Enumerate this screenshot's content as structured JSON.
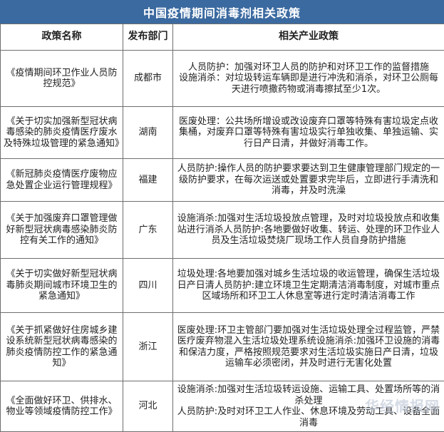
{
  "title": "中国疫情期间消毒剂相关政策",
  "headers": {
    "name": "政策名称",
    "region": "发布部门",
    "policy": "相关产业政策"
  },
  "rows": [
    {
      "name": "《疫情期间环卫作业人员防控规范》",
      "region": "成都市",
      "policy": "人员防护：加强对环卫人员的防护和对环卫工作的监督措施\n设施消杀：对垃圾转运车辆即是进行冲洗和消杀，对环卫公厕每天进行喷撒药物或消毒擦拭至少1次。"
    },
    {
      "name": "《关于切实加强新型冠状病毒感染的肺炎疫情医疗废水及特殊垃圾管理的紧急通知》",
      "region": "湖南",
      "policy": "医废处理：公共场所增设或改设废弃口罩等特殊有害垃圾定点收集桶，对废弃口罩等特殊有害垃圾实行单独收集、单独运输、实行日产日清，并做好消毒工作。"
    },
    {
      "name": "《新冠肺炎疫情医疗废物应急处置企业运行管理规程》",
      "region": "福建",
      "policy": "人员防护:操作人员的防护要求要达到卫生健康管理部门规定的一级防护要求，在每次运送或处置要求完毕后，立即进行手清洗和消毒，并及时洗澡"
    },
    {
      "name": "《关于加强废弃口罩管理做好新型冠状病毒感染肺炎防控有关工作的通知》",
      "region": "广东",
      "policy": "设施消杀:加强对生活垃圾投放点管理，及时对垃圾投放点和收集站进行消杀人员防护:各地要做好收集、转运、处理的环卫作业人员及生活垃圾焚烧厂现场工作人员自身防护措施"
    },
    {
      "name": "《关于切实做好新型冠状病毒肺炎期间城市环境卫生的紧急通知》",
      "region": "四川",
      "policy": "垃圾处理:各地要加强对城乡生活垃圾的收运管理，确保生活垃圾日产日清人员防护:建立环境卫生定期清洁消毒制度，对城市重点区域场所和环卫工人休息室等进行定时清洁消毒工作"
    },
    {
      "name": "《关于抓紧做好住房城乡建设系统新型冠状病毒感染的肺炎疫情防控工作的紧急通知》",
      "region": "浙江",
      "policy": "医废处理:环卫主管部门要加强对生活垃圾处理全过程监管，严禁医疗废弃物混入生活垃圾处理系统设施消杀:加强环卫设施的消毒和保洁力度，严格按照规范要求对生活垃圾实施日产日清，垃圾运输车必须密闭，并及时进行无害化处置"
    },
    {
      "name": "《全面做好环卫、供排水、物业等领域疫情防控工作》",
      "region": "河北",
      "policy": "设施消杀:加强对生活垃圾转运设施、运输工具、处置场所等的消杀处理\n人员防护:及时对环卫工人作业、休息环境及劳动工具、设备全面消毒"
    }
  ],
  "watermark": "华经情报网"
}
